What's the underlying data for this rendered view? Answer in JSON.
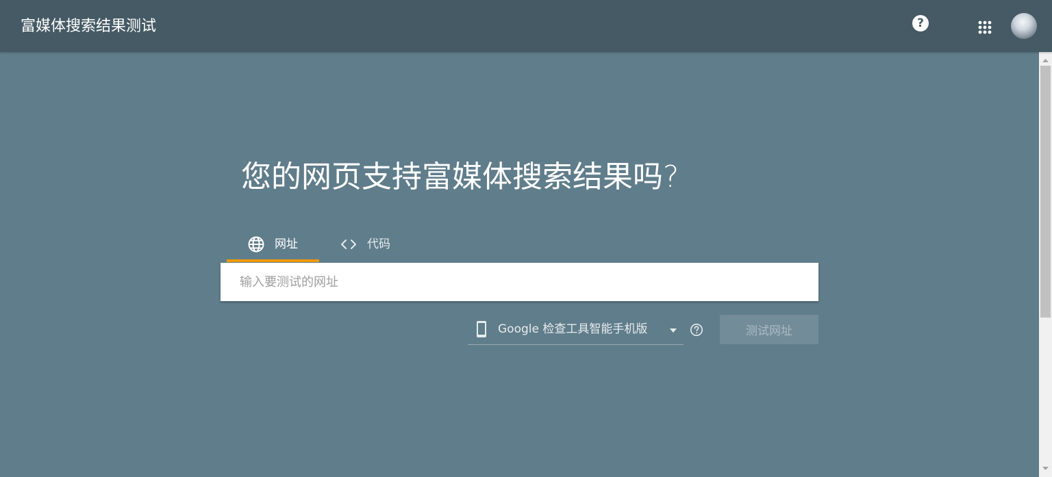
{
  "header": {
    "title": "富媒体搜索结果测试",
    "help_icon": "help-circle-icon",
    "help_glyph": "?",
    "apps_icon": "apps-grid-icon",
    "avatar_icon": "user-avatar"
  },
  "main": {
    "headline": "您的网页支持富媒体搜索结果吗?",
    "tabs": [
      {
        "label": "网址",
        "icon": "globe-icon",
        "selected": true
      },
      {
        "label": "代码",
        "icon": "code-brackets-icon",
        "selected": false
      }
    ],
    "url_input": {
      "placeholder": "输入要测试的网址",
      "value": ""
    },
    "crawler_select": {
      "icon": "smartphone-icon",
      "selected": "Google 检查工具智能手机版"
    },
    "test_button_label": "测试网址"
  },
  "colors": {
    "app_bar": "#455a64",
    "background": "#607d8b",
    "tab_indicator": "#f29900",
    "text": "#ffffff"
  }
}
